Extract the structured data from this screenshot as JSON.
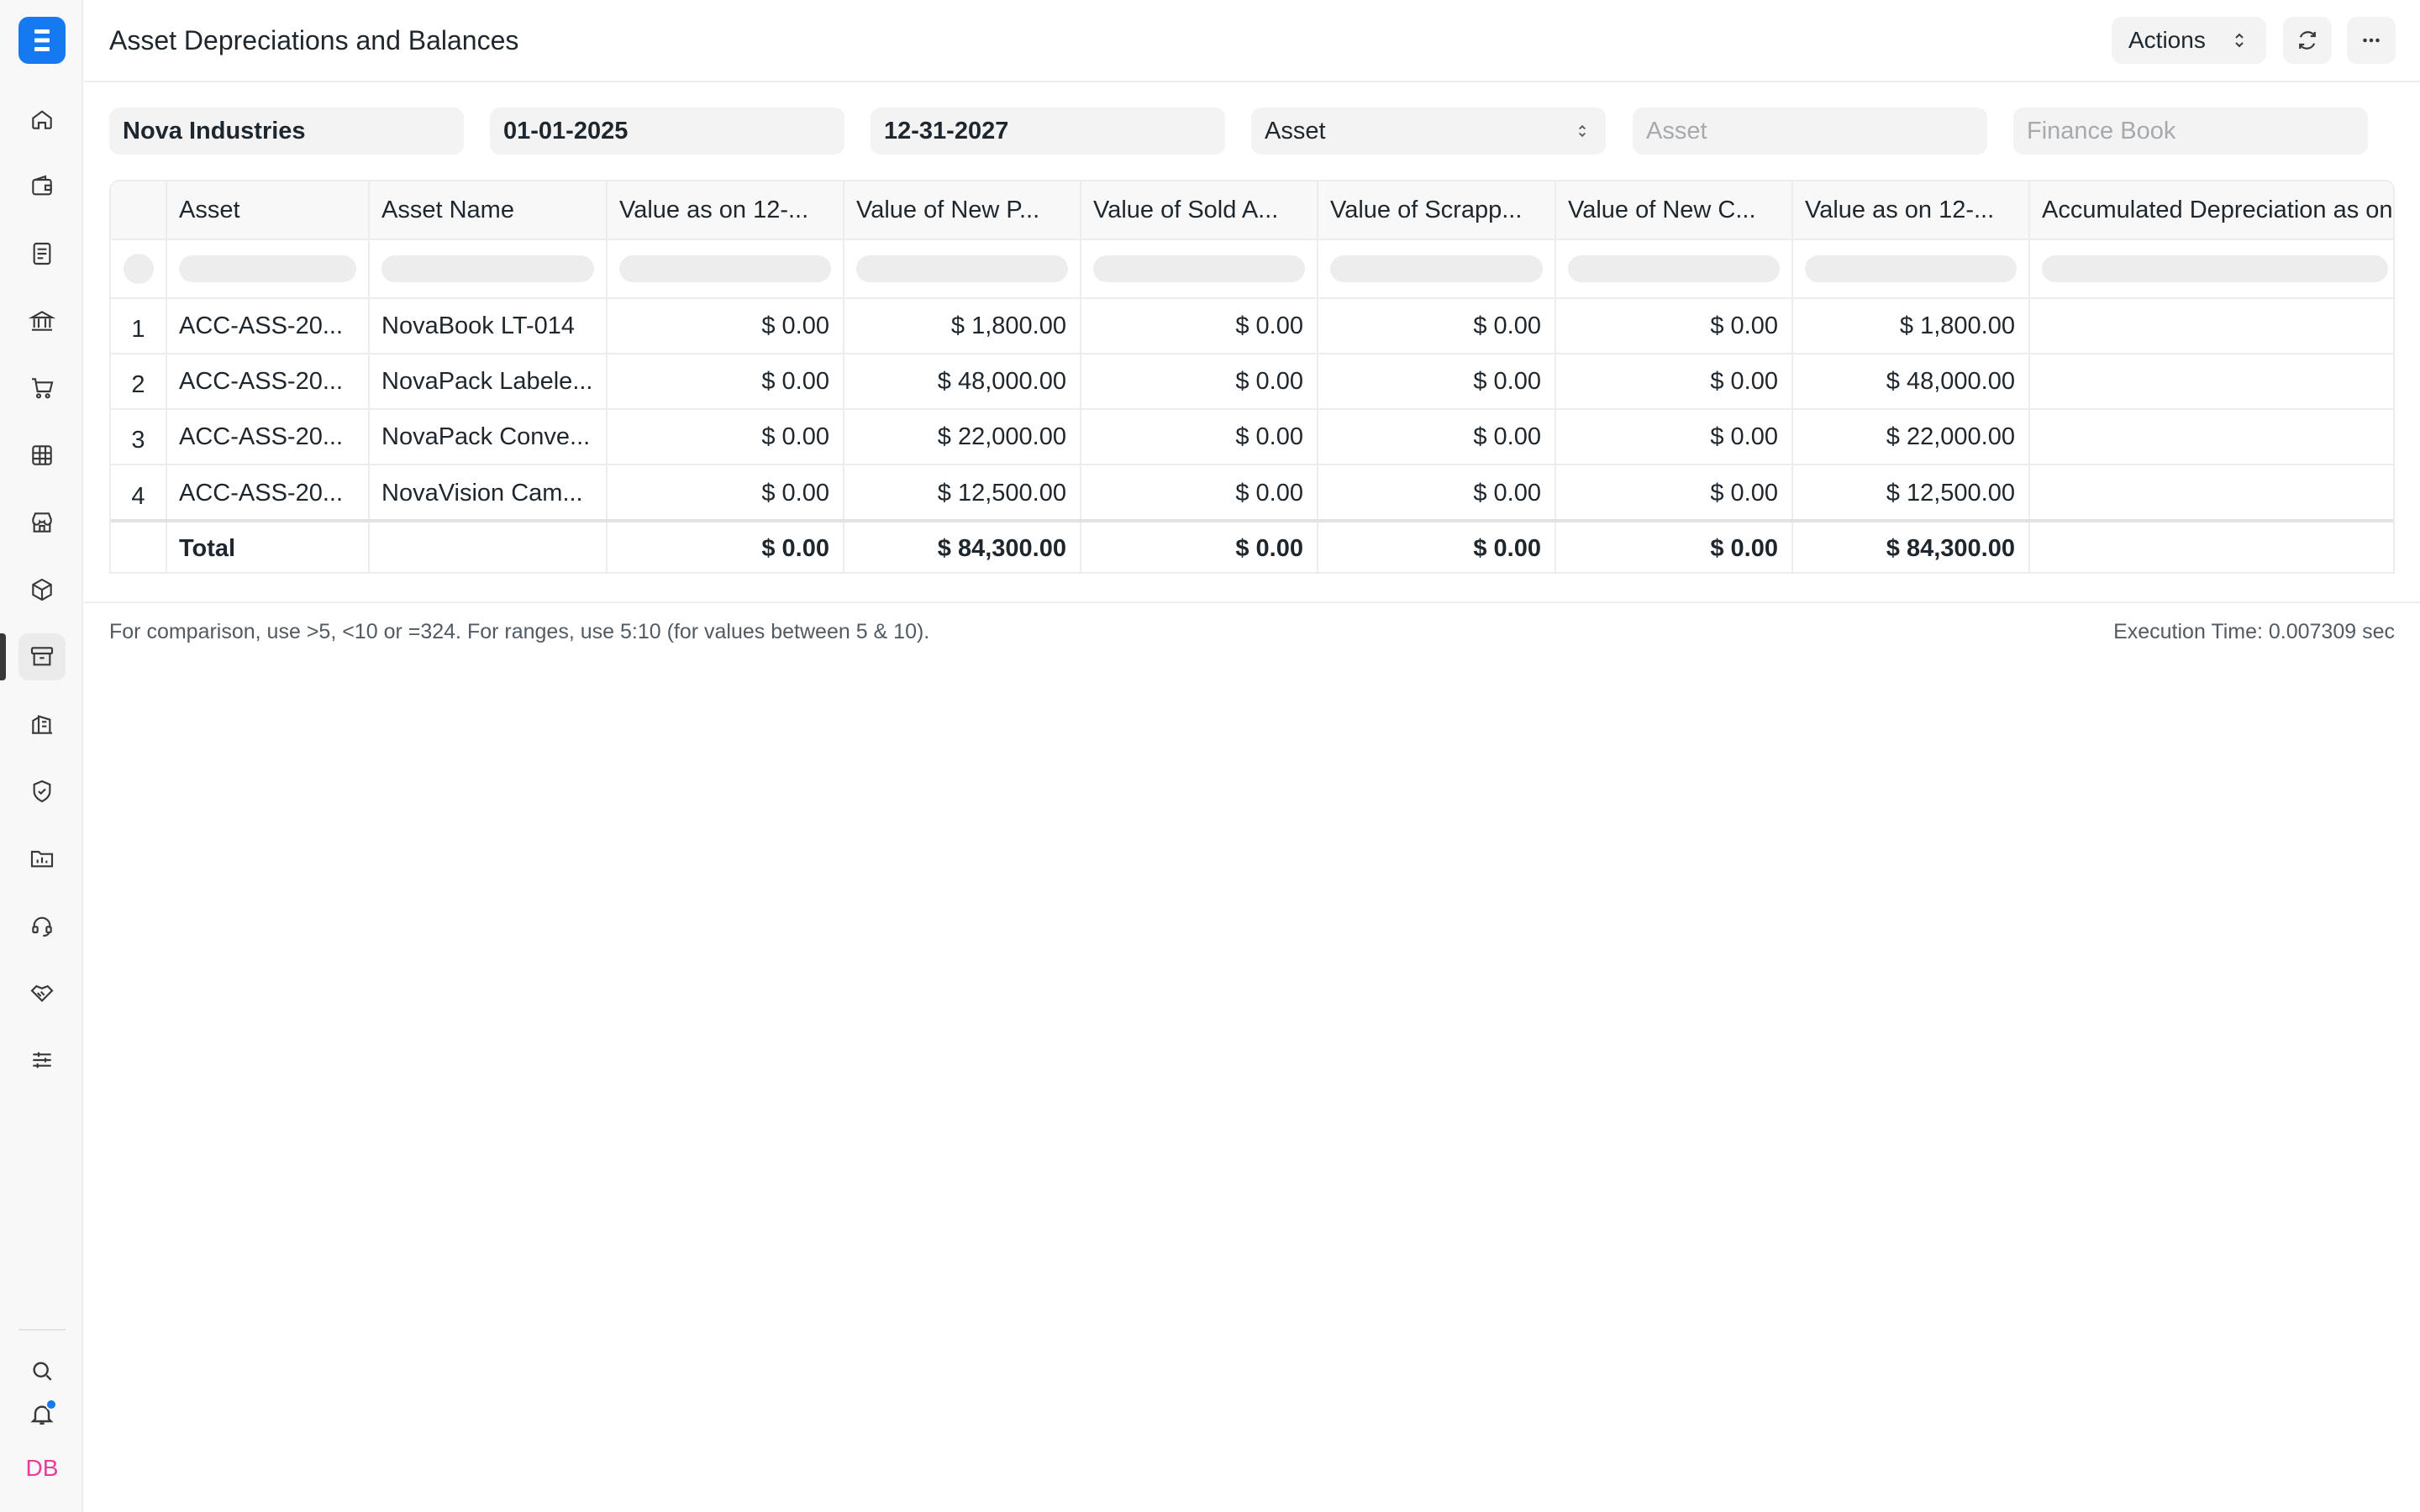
{
  "sidebar": {
    "logo_letter": "E",
    "items": [
      {
        "name": "home-icon"
      },
      {
        "name": "wallet-icon"
      },
      {
        "name": "document-icon"
      },
      {
        "name": "bank-icon"
      },
      {
        "name": "cart-icon"
      },
      {
        "name": "table-icon"
      },
      {
        "name": "store-icon"
      },
      {
        "name": "package-icon"
      },
      {
        "name": "archive-icon",
        "active": true
      },
      {
        "name": "building-icon"
      },
      {
        "name": "shield-icon"
      },
      {
        "name": "folder-chart-icon"
      },
      {
        "name": "headset-icon"
      },
      {
        "name": "handshake-icon"
      },
      {
        "name": "sliders-icon"
      }
    ],
    "bottom": {
      "search": "search-icon",
      "notifications": "bell-icon",
      "avatar_initials": "DB",
      "avatar_color": "#e93f9a"
    }
  },
  "header": {
    "title": "Asset Depreciations and Balances",
    "actions_label": "Actions"
  },
  "filters": {
    "company": "Nova Industries",
    "from_date": "01-01-2025",
    "to_date": "12-31-2027",
    "group_by": "Asset",
    "asset_placeholder": "Asset",
    "finance_book_placeholder": "Finance Book"
  },
  "table": {
    "columns": [
      "Asset",
      "Asset Name",
      "Value as on 12-...",
      "Value of New P...",
      "Value of Sold A...",
      "Value of Scrapp...",
      "Value of New C...",
      "Value as on 12-...",
      "Accumulated Depreciation as on"
    ],
    "rows": [
      {
        "idx": "1",
        "asset": "ACC-ASS-20...",
        "name": "NovaBook LT-014",
        "v1": "$ 0.00",
        "v2": "$ 1,800.00",
        "v3": "$ 0.00",
        "v4": "$ 0.00",
        "v5": "$ 0.00",
        "v6": "$ 1,800.00"
      },
      {
        "idx": "2",
        "asset": "ACC-ASS-20...",
        "name": "NovaPack Labele...",
        "v1": "$ 0.00",
        "v2": "$ 48,000.00",
        "v3": "$ 0.00",
        "v4": "$ 0.00",
        "v5": "$ 0.00",
        "v6": "$ 48,000.00"
      },
      {
        "idx": "3",
        "asset": "ACC-ASS-20...",
        "name": "NovaPack Conve...",
        "v1": "$ 0.00",
        "v2": "$ 22,000.00",
        "v3": "$ 0.00",
        "v4": "$ 0.00",
        "v5": "$ 0.00",
        "v6": "$ 22,000.00"
      },
      {
        "idx": "4",
        "asset": "ACC-ASS-20...",
        "name": "NovaVision Cam...",
        "v1": "$ 0.00",
        "v2": "$ 12,500.00",
        "v3": "$ 0.00",
        "v4": "$ 0.00",
        "v5": "$ 0.00",
        "v6": "$ 12,500.00"
      }
    ],
    "total": {
      "label": "Total",
      "v1": "$ 0.00",
      "v2": "$ 84,300.00",
      "v3": "$ 0.00",
      "v4": "$ 0.00",
      "v5": "$ 0.00",
      "v6": "$ 84,300.00"
    }
  },
  "footer": {
    "hint": "For comparison, use >5, <10 or =324. For ranges, use 5:10 (for values between 5 & 10).",
    "execution_time": "Execution Time: 0.007309 sec"
  },
  "colors": {
    "accent": "#1579f2",
    "border": "#ededed",
    "muted_bg": "#f3f3f3"
  }
}
